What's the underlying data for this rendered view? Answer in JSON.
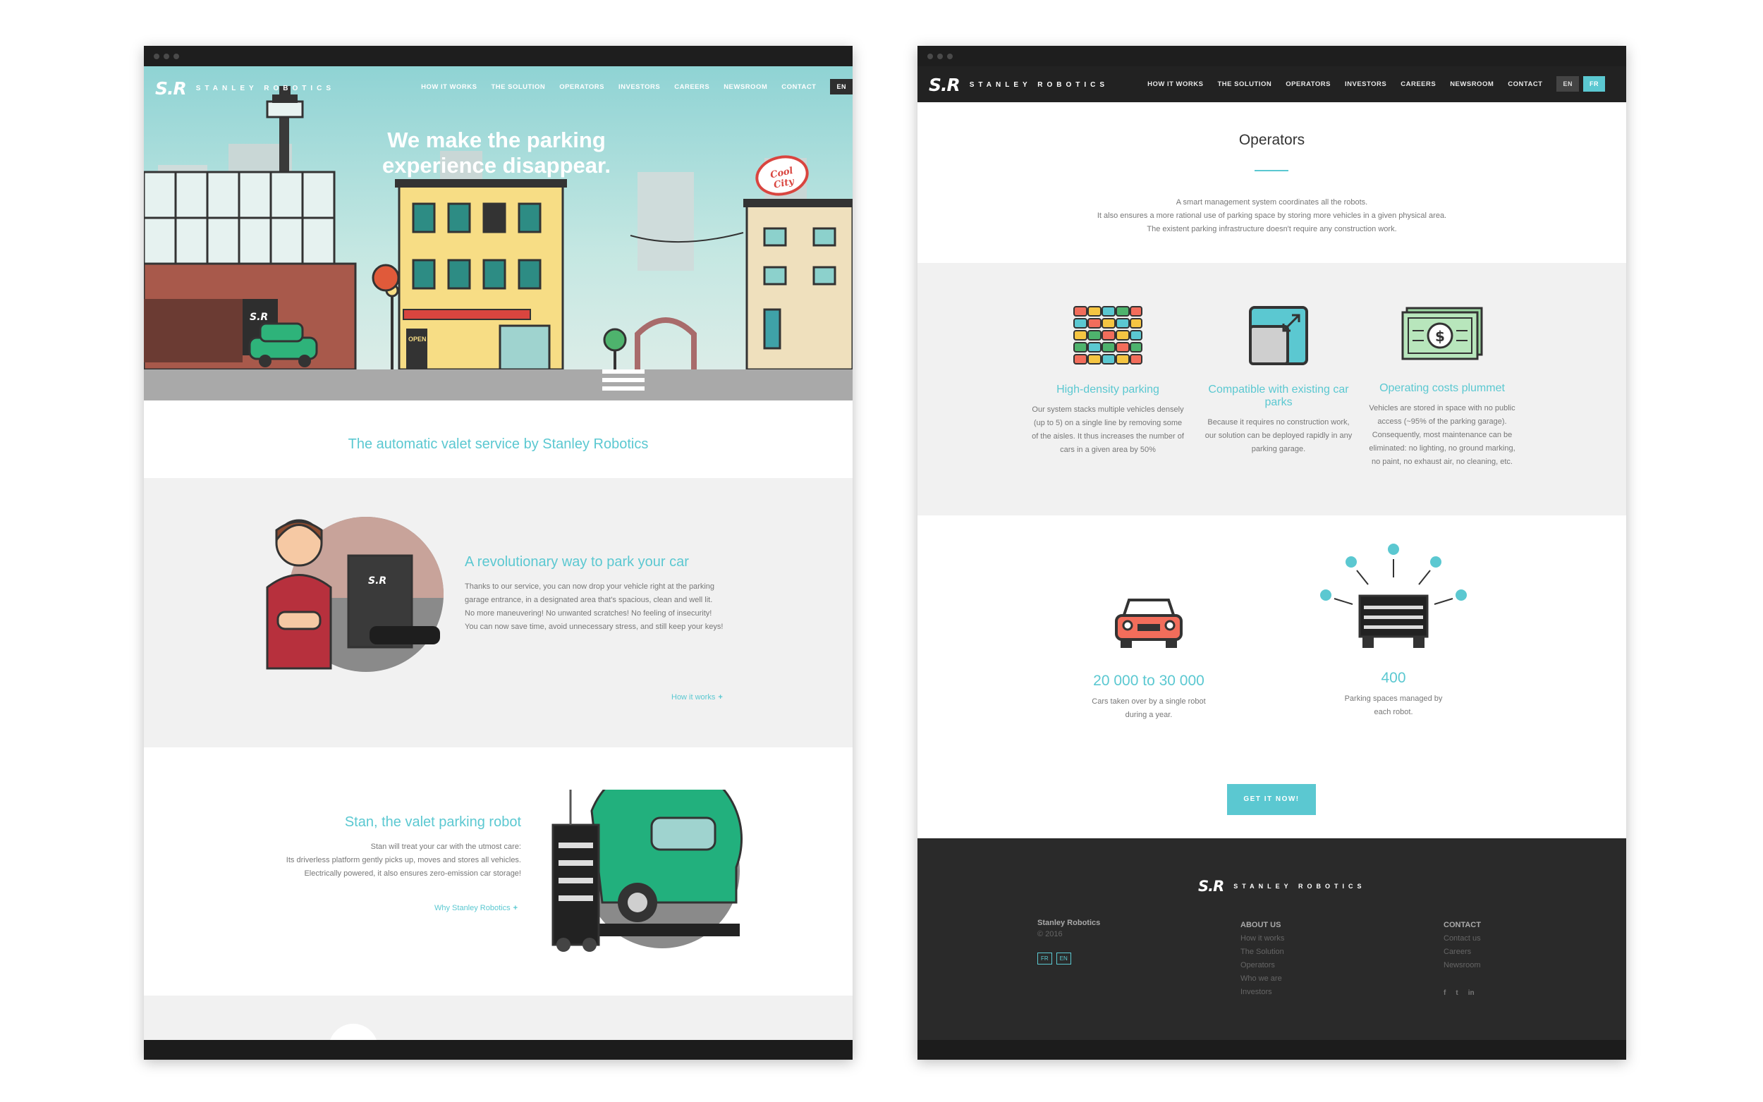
{
  "brand": {
    "mark": "S.R",
    "name": "STANLEY ROBOTICS"
  },
  "nav": {
    "items": [
      "HOW IT WORKS",
      "THE SOLUTION",
      "OPERATORS",
      "INVESTORS",
      "CAREERS",
      "NEWSROOM",
      "CONTACT"
    ],
    "lang_en": "EN",
    "lang_fr": "FR"
  },
  "home": {
    "hero_title": "We make the parking experience disappear.",
    "hero_sign": "Cool City",
    "hero_open_sign": "OPEN",
    "subtitle": "The automatic valet service by Stanley Robotics",
    "feature1": {
      "title": "A revolutionary way to park your car",
      "paragraphs": [
        "Thanks to our service, you can now drop your vehicle right at the parking garage entrance, in a designated area that's spacious, clean and well lit.",
        "No more maneuvering! No unwanted scratches! No feeling of insecurity!",
        "You can now save time, avoid unnecessary stress, and still keep your keys!"
      ],
      "link": "How it works"
    },
    "feature2": {
      "title": "Stan, the valet parking robot",
      "paragraphs": [
        "Stan will treat your car with the utmost care:",
        "Its driverless platform gently picks up, moves and stores all vehicles.",
        "Electrically powered, it also ensures zero-emission car storage!"
      ],
      "link": "Why Stanley Robotics"
    }
  },
  "operators": {
    "title": "Operators",
    "intro": [
      "A smart management system coordinates all the robots.",
      "It also ensures a more rational use of parking space by storing more vehicles in a given physical area.",
      "The existent parking infrastructure doesn't require any construction work."
    ],
    "benefits": [
      {
        "icon": "stacked-cars-icon",
        "title": "High-density parking",
        "text": "Our system stacks multiple vehicles densely (up to 5) on a single line by removing some of the aisles. It thus increases the number of cars in a given area by 50%"
      },
      {
        "icon": "resize-icon",
        "title": "Compatible with existing car parks",
        "text": "Because it requires no construction work, our solution can be deployed rapidly in any parking garage."
      },
      {
        "icon": "dollar-bill-icon",
        "title": "Operating costs plummet",
        "text": "Vehicles are stored in space with no public access (~95% of the parking garage). Consequently, most maintenance can be eliminated: no lighting, no ground marking, no paint, no exhaust air, no cleaning, etc."
      }
    ],
    "stats": [
      {
        "value": "20 000 to 30 000",
        "label": "Cars taken over by a single robot during a year."
      },
      {
        "value": "400",
        "label": "Parking spaces managed by each robot."
      }
    ],
    "cta": "GET IT NOW!"
  },
  "footer": {
    "company": "Stanley Robotics",
    "year": "© 2016",
    "lang_fr": "FR",
    "lang_en": "EN",
    "about_title": "ABOUT US",
    "about_links": [
      "How it works",
      "The Solution",
      "Operators",
      "Who we are",
      "Investors"
    ],
    "contact_title": "CONTACT",
    "contact_links": [
      "Contact us",
      "Careers",
      "Newsroom"
    ],
    "social": [
      "f",
      "t",
      "in"
    ]
  },
  "colors": {
    "accent": "#5bc8d1",
    "dark": "#2a2a2a",
    "light_gray": "#f1f1f1"
  }
}
